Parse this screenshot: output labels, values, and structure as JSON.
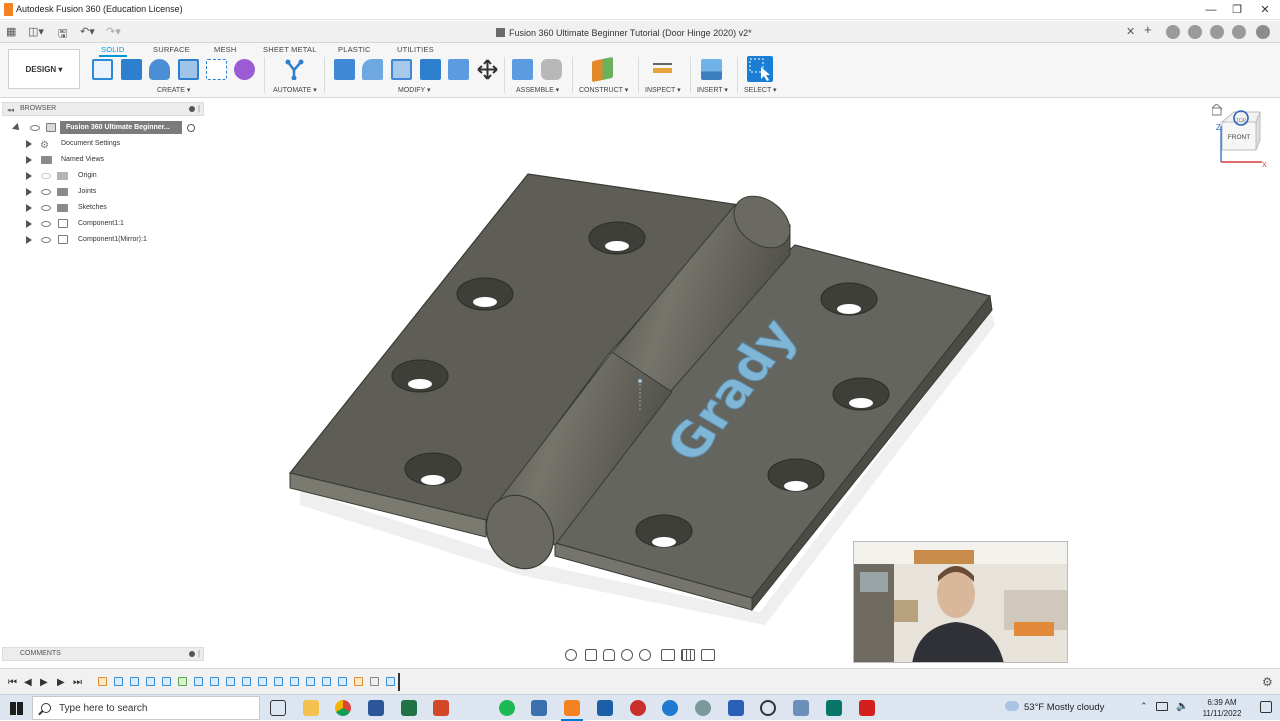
{
  "window": {
    "title": "Autodesk Fusion 360 (Education License)"
  },
  "document": {
    "tab_title": "Fusion 360 Ultimate Beginner Tutorial (Door Hinge 2020) v2*"
  },
  "ribbon": {
    "workspace": "DESIGN ▾",
    "tabs": [
      "SOLID",
      "SURFACE",
      "MESH",
      "SHEET METAL",
      "PLASTIC",
      "UTILITIES"
    ],
    "active_tab": "SOLID",
    "groups": {
      "create": "CREATE ▾",
      "automate": "AUTOMATE ▾",
      "modify": "MODIFY ▾",
      "assemble": "ASSEMBLE ▾",
      "construct": "CONSTRUCT ▾",
      "inspect": "INSPECT ▾",
      "insert": "INSERT ▾",
      "select": "SELECT ▾"
    }
  },
  "browser": {
    "label": "BROWSER",
    "root": "Fusion 360 Ultimate Beginner...",
    "items": [
      {
        "label": "Document Settings",
        "icon": "gear-icon"
      },
      {
        "label": "Named Views",
        "icon": "folder-icon"
      },
      {
        "label": "Origin",
        "icon": "folder-icon"
      },
      {
        "label": "Joints",
        "icon": "folder-icon"
      },
      {
        "label": "Sketches",
        "icon": "folder-icon"
      },
      {
        "label": "Component1:1",
        "icon": "component-icon"
      },
      {
        "label": "Component1(Mirror):1",
        "icon": "component-icon"
      }
    ]
  },
  "comments": {
    "label": "COMMENTS"
  },
  "viewcube": {
    "face": "FRONT",
    "top_face": "TOP",
    "axis_z": "Z",
    "axis_x": "X"
  },
  "model": {
    "engraved_text": "Grady"
  },
  "taskbar": {
    "search_placeholder": "Type here to search",
    "weather": "53°F  Mostly cloudy",
    "time": "6:39 AM",
    "date": "11/11/2022"
  },
  "colors": {
    "accent": "#0696d7",
    "hinge_dark": "#5a5a52",
    "hinge_light": "#6f6f67",
    "engraving": "#7fb6d6",
    "app_orange": "#f58220"
  }
}
